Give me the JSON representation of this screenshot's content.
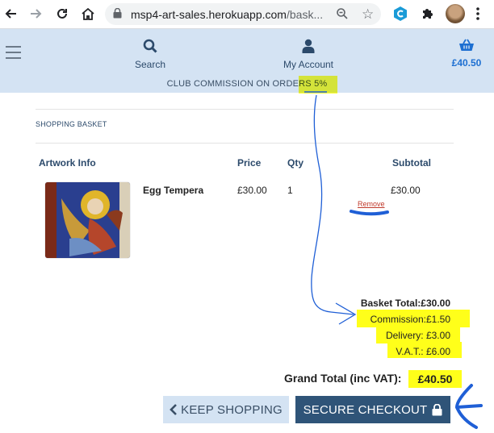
{
  "browser": {
    "url_host": "msp4-art-sales.herokuapp.com",
    "url_rest": "/bask..."
  },
  "header": {
    "search_label": "Search",
    "account_label": "My Account",
    "basket_total": "£40.50",
    "commission_banner": "CLUB COMMISSION ON ORDERS 5%"
  },
  "basket": {
    "section_title": "SHOPPING BASKET",
    "columns": {
      "artwork": "Artwork Info",
      "price": "Price",
      "qty": "Qty",
      "subtotal": "Subtotal"
    },
    "items": [
      {
        "title": "Egg Tempera",
        "price": "£30.00",
        "qty": "1",
        "subtotal": "£30.00",
        "remove_label": "Remove"
      }
    ]
  },
  "totals": {
    "basket_total": "Basket Total:£30.00",
    "commission": "Commission:£1.50",
    "delivery": "Delivery: £3.00",
    "vat": "V.A.T.: £6.00",
    "grand_total_label": "Grand Total (inc VAT):",
    "grand_total_value": "£40.50"
  },
  "actions": {
    "keep_shopping": "KEEP SHOPPING",
    "secure_checkout": "SECURE CHECKOUT"
  },
  "colors": {
    "header_bg": "#d4e3f3",
    "primary_button": "#2f5478",
    "highlight": "#ffff1a",
    "annotation_blue": "#1f5fd6",
    "remove_red": "#c0392b"
  }
}
